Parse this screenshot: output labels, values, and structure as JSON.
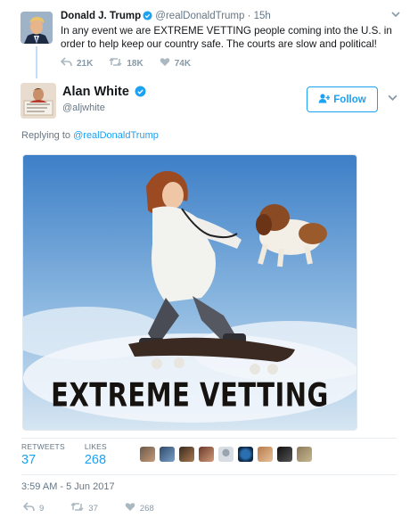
{
  "parent_tweet": {
    "name": "Donald J. Trump",
    "handle": "@realDonaldTrump",
    "time": "· 15h",
    "text": "In any event we are EXTREME VETTING people coming into the U.S. in order to help keep our country safe. The courts are slow and political!",
    "reply_count": "21K",
    "retweet_count": "18K",
    "like_count": "74K"
  },
  "tweet": {
    "name": "Alan White",
    "handle": "@aljwhite",
    "follow_label": "Follow",
    "replying_prefix": "Replying to",
    "replying_handle": "@realDonaldTrump",
    "image_caption": "EXTREME VETTING",
    "retweets_label": "RETWEETS",
    "retweets_value": "37",
    "likes_label": "LIKES",
    "likes_value": "268",
    "timestamp": "3:59 AM - 5 Jun 2017",
    "reply_count": "9",
    "retweet_count": "37",
    "like_count": "268"
  },
  "colors": {
    "accent": "#1da1f2",
    "muted": "#657786",
    "verified": "#1da1f2"
  },
  "icons": [
    "verified-badge-icon",
    "reply-icon",
    "retweet-icon",
    "heart-icon",
    "chevron-down-icon",
    "follow-user-icon"
  ]
}
